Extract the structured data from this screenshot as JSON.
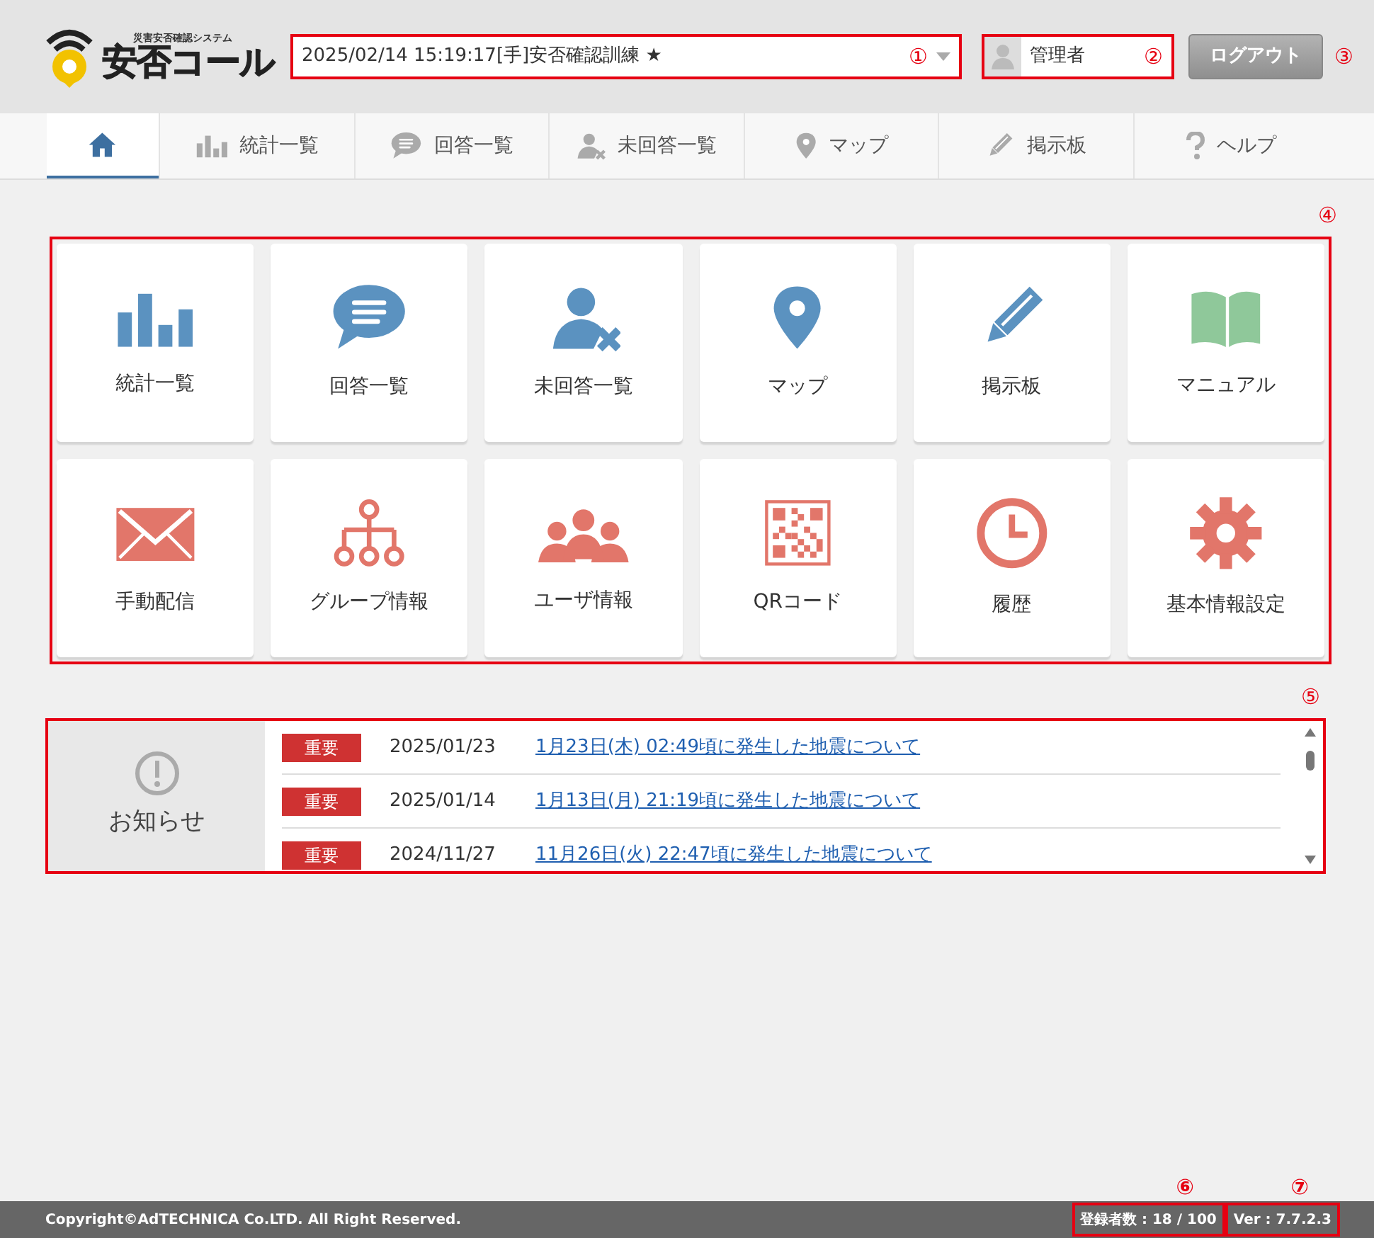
{
  "header": {
    "logo_tagline": "災害安否確認システム",
    "logo_text": "安否コール",
    "event_select": {
      "value": "2025/02/14 15:19:17[手]安否確認訓練 ★",
      "callout": "①"
    },
    "user": {
      "name": "管理者",
      "callout": "②"
    },
    "logout": {
      "label": "ログアウト",
      "callout": "③"
    }
  },
  "nav": [
    {
      "selected": true
    },
    {
      "label": "統計一覧",
      "selected": false
    },
    {
      "label": "回答一覧",
      "selected": false
    },
    {
      "label": "未回答一覧",
      "selected": false
    },
    {
      "label": "マップ",
      "selected": false
    },
    {
      "label": "掲示板",
      "selected": false
    },
    {
      "label": "ヘルプ",
      "selected": false
    }
  ],
  "tiles": {
    "callout": "④",
    "items": [
      {
        "label": "統計一覧"
      },
      {
        "label": "回答一覧"
      },
      {
        "label": "未回答一覧"
      },
      {
        "label": "マップ"
      },
      {
        "label": "掲示板"
      },
      {
        "label": "マニュアル"
      },
      {
        "label": "手動配信"
      },
      {
        "label": "グループ情報"
      },
      {
        "label": "ユーザ情報"
      },
      {
        "label": "QRコード"
      },
      {
        "label": "履歴"
      },
      {
        "label": "基本情報設定"
      }
    ]
  },
  "notices": {
    "title": "お知らせ",
    "callout": "⑤",
    "items": [
      {
        "tag": "重要",
        "date": "2025/01/23",
        "title": "1月23日(木) 02:49頃に発生した地震について"
      },
      {
        "tag": "重要",
        "date": "2025/01/14",
        "title": "1月13日(月) 21:19頃に発生した地震について"
      },
      {
        "tag": "重要",
        "date": "2024/11/27",
        "title": "11月26日(火) 22:47頃に発生した地震について"
      }
    ]
  },
  "footer": {
    "copyright": "Copyright©AdTECHNICA Co.LTD. All Right Reserved.",
    "count": {
      "text": "登録者数 : 18 / 100",
      "callout": "⑥"
    },
    "version": {
      "text": "Ver : 7.7.2.3",
      "callout": "⑦"
    }
  }
}
